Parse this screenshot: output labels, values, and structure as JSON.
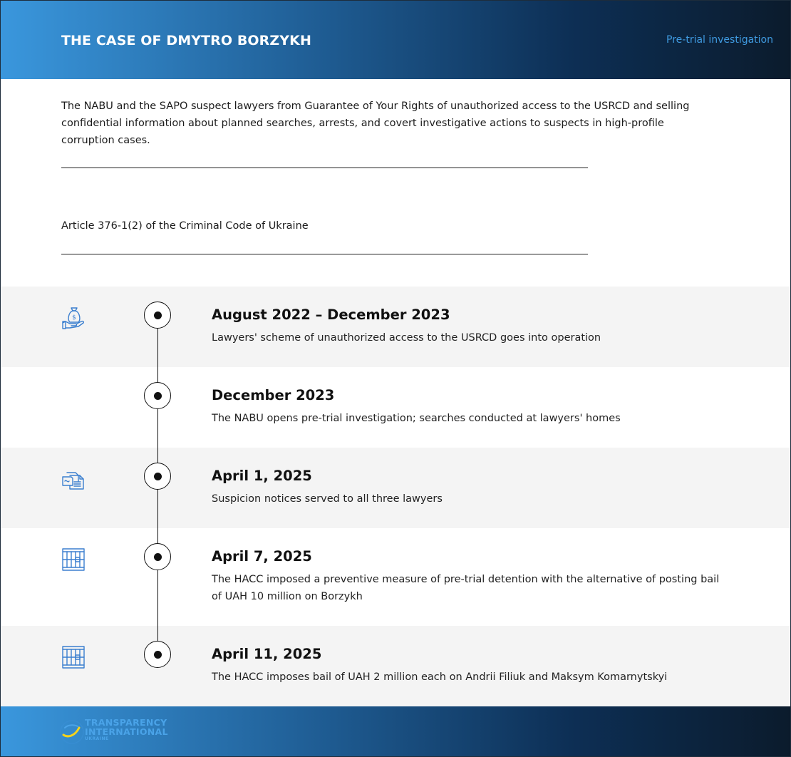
{
  "header": {
    "title": "THE CASE OF DMYTRO BORZYKH",
    "status": "Pre-trial investigation"
  },
  "summary": "The NABU and the SAPO suspect lawyers from Guarantee of Your Rights of unauthorized access to the USRCD and selling confidential information about planned searches, arrests, and covert investigative actions to suspects in high-profile corruption cases.",
  "article": "Article 376-1(2) of the Criminal Code of Ukraine",
  "timeline": [
    {
      "date": "August 2022 – December 2023",
      "description": "Lawyers' scheme of unauthorized access to the USRCD goes into operation",
      "icon": "money-bag-hand-icon"
    },
    {
      "date": "December 2023",
      "description": "The NABU opens pre-trial investigation; searches conducted at lawyers' homes",
      "icon": ""
    },
    {
      "date": "April 1, 2025",
      "description": "Suspicion notices served to all three lawyers",
      "icon": "documents-icon"
    },
    {
      "date": "April 7, 2025",
      "description": "The HACC imposed a preventive measure of pre-trial detention with the alternative of posting bail of UAH 10 million on Borzykh",
      "icon": "prison-bars-icon"
    },
    {
      "date": "April 11, 2025",
      "description": "The HACC imposes bail of UAH 2 million each on Andrii Filiuk and Maksym Komarnytskyi",
      "icon": "prison-bars-icon"
    }
  ],
  "footer": {
    "logo_line1": "TRANSPARENCY",
    "logo_line2": "INTERNATIONAL",
    "logo_line3": "UKRAINE"
  },
  "colors": {
    "accent_blue": "#3a97dd",
    "dark_navy": "#0b1b2c",
    "row_shade": "#f4f4f4",
    "icon_blue": "#3b7fcf",
    "logo_yellow": "#f5d31c"
  }
}
